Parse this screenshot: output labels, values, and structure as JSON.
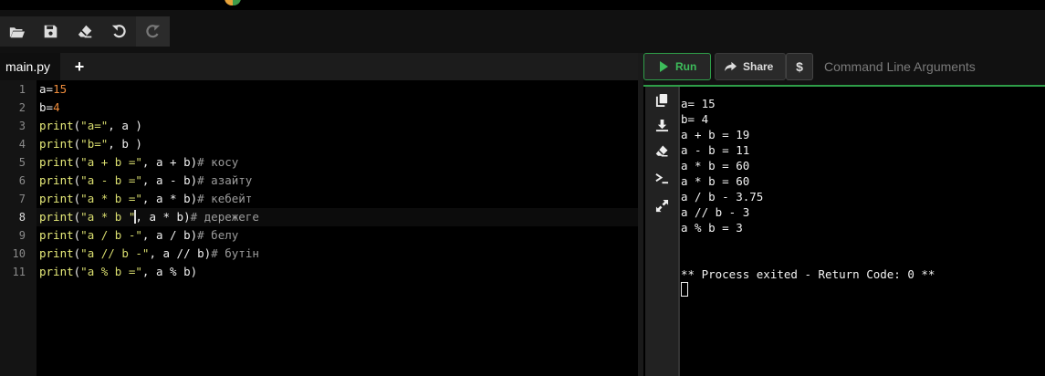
{
  "toolbar": {
    "buttons": [
      {
        "name": "open-icon",
        "enabled": true
      },
      {
        "name": "save-icon",
        "enabled": true
      },
      {
        "name": "eraser-icon",
        "enabled": true
      },
      {
        "name": "undo-icon",
        "enabled": true
      },
      {
        "name": "redo-icon",
        "enabled": false
      }
    ]
  },
  "editor": {
    "tab_label": "main.py",
    "add_tab_label": "+",
    "active_line": 8,
    "line_numbers": [
      "1",
      "2",
      "3",
      "4",
      "5",
      "6",
      "7",
      "8",
      "9",
      "10",
      "11"
    ],
    "lines": [
      "a=15",
      "b=4",
      "print(\"a=\", a )",
      "print(\"b=\", b )",
      "print(\"a + b =\", a + b)# косу",
      "print(\"a - b =\", a - b)# азайту",
      "print(\"a * b =\", a * b)# кебейт",
      "print(\"a * b =\", a * b)# дережеге",
      "print(\"a / b -\", a / b)# белу",
      "print(\"a // b -\", a // b)# бутін",
      "print(\"a % b =\", a % b)"
    ]
  },
  "runbar": {
    "run_label": "Run",
    "share_label": "Share",
    "dollar_label": "$",
    "args_placeholder": "Command Line Arguments",
    "accent_color": "#3dbd5b"
  },
  "output": {
    "side_icons": [
      "copy-icon",
      "download-icon",
      "eraser-icon",
      "terminal-icon",
      "expand-icon"
    ],
    "lines": [
      "a= 15",
      "b= 4",
      "a + b = 19",
      "a - b = 11",
      "a * b = 60",
      "a * b = 60",
      "a / b - 3.75",
      "a // b - 3",
      "a % b = 3",
      "",
      "",
      "** Process exited - Return Code: 0 **"
    ]
  }
}
